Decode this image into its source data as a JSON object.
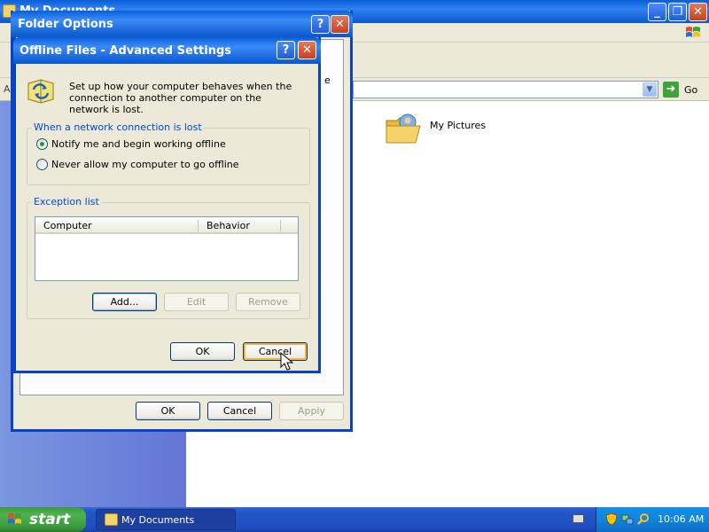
{
  "my_documents": {
    "title": "My Documents",
    "address_label": "A",
    "go_label": "Go",
    "items": [
      {
        "label": "My Pictures"
      }
    ]
  },
  "folder_options": {
    "title": "Folder Options",
    "tab_fragment": "e",
    "buttons": {
      "ok": "OK",
      "cancel": "Cancel",
      "apply": "Apply"
    }
  },
  "offline_dialog": {
    "title": "Offline Files - Advanced Settings",
    "description": "Set up how your computer behaves when the connection to another computer on the network is lost.",
    "network_group": {
      "title": "When a network connection is lost",
      "options": [
        {
          "label": "Notify me and begin working offline",
          "checked": true
        },
        {
          "label": "Never allow my computer to go offline",
          "checked": false
        }
      ]
    },
    "exception_group": {
      "title": "Exception list",
      "columns": [
        "Computer",
        "Behavior"
      ],
      "rows": [],
      "buttons": {
        "add": "Add...",
        "edit": "Edit",
        "remove": "Remove"
      }
    },
    "buttons": {
      "ok": "OK",
      "cancel": "Cancel"
    },
    "title_buttons": {
      "help": "?",
      "close": "✕"
    }
  },
  "taskbar": {
    "start_label": "start",
    "tasks": [
      {
        "label": "My Documents"
      }
    ],
    "clock": "10:06 AM"
  },
  "icons": {
    "help": "help-icon",
    "close": "close-icon",
    "minimize": "minimize-icon",
    "maximize": "maximize-icon",
    "go": "go-arrow-icon",
    "folder": "my-pictures-folder-icon",
    "offline": "offline-sync-icon"
  },
  "colors": {
    "titlebar_blue": "#0a5fd8",
    "close_red": "#c6421f",
    "group_title": "#0046d5",
    "start_green": "#3c9a3c",
    "tray_blue": "#0f84df",
    "left_pane": "#6375d6"
  }
}
